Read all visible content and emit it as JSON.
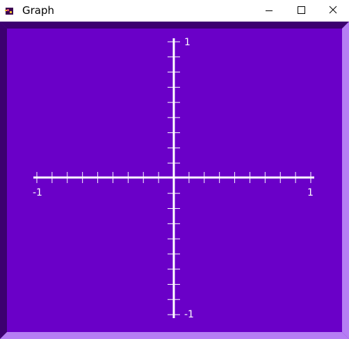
{
  "window": {
    "title": "Graph",
    "app_icon": "app-icon",
    "controls": [
      "minimize-icon",
      "maximize-icon",
      "close-icon"
    ]
  },
  "colors": {
    "background": "#6a00c8",
    "bevel_dark": "#3c0070",
    "bevel_light": "#b57ef4",
    "axis": "#ffffff"
  },
  "graph": {
    "x_range": [
      -1,
      1
    ],
    "y_range": [
      -1,
      1
    ],
    "x_ticks": 18,
    "y_ticks": 18,
    "labels": {
      "x_min": "-1",
      "x_max": "1",
      "y_max": "1",
      "y_min": "-1"
    }
  }
}
